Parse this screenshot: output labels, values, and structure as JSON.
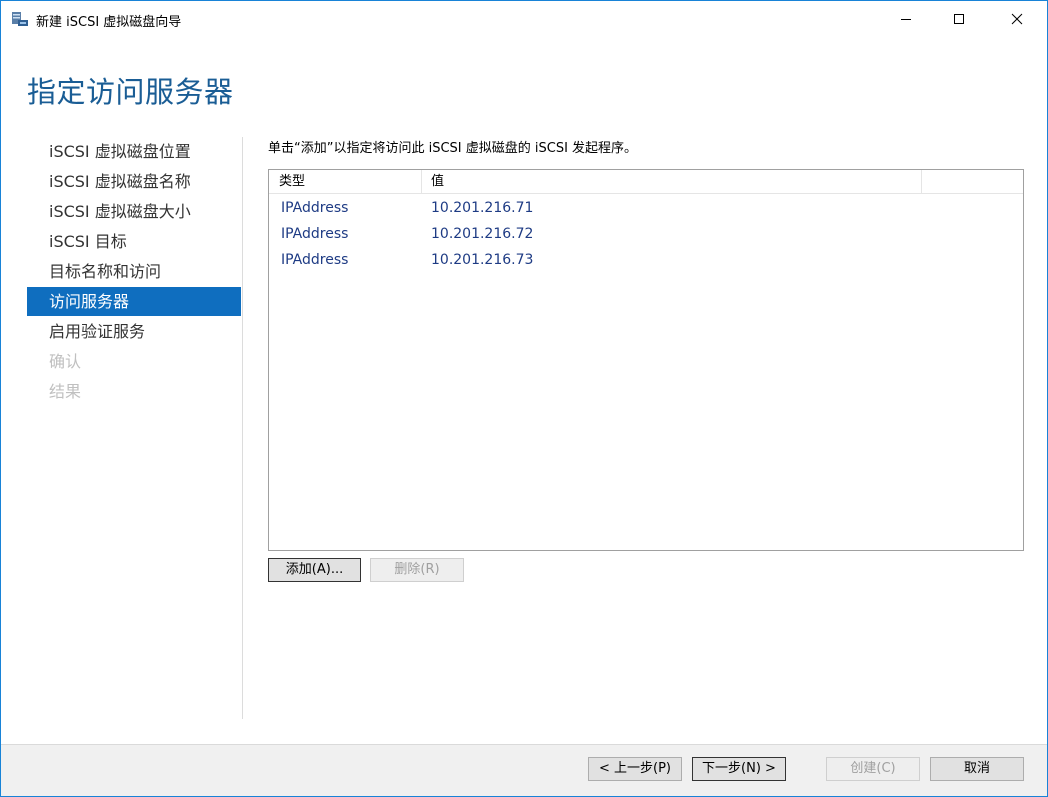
{
  "window": {
    "title": "新建 iSCSI 虚拟磁盘向导",
    "accent_color": "#1883d7"
  },
  "page": {
    "title": "指定访问服务器",
    "instruction": "单击“添加”以指定将访问此 iSCSI 虚拟磁盘的 iSCSI 发起程序。"
  },
  "nav": {
    "items": [
      {
        "label": "iSCSI 虚拟磁盘位置",
        "state": "normal"
      },
      {
        "label": "iSCSI 虚拟磁盘名称",
        "state": "normal"
      },
      {
        "label": "iSCSI 虚拟磁盘大小",
        "state": "normal"
      },
      {
        "label": "iSCSI 目标",
        "state": "normal"
      },
      {
        "label": "目标名称和访问",
        "state": "normal"
      },
      {
        "label": "访问服务器",
        "state": "selected"
      },
      {
        "label": "启用验证服务",
        "state": "normal"
      },
      {
        "label": "确认",
        "state": "disabled"
      },
      {
        "label": "结果",
        "state": "disabled"
      }
    ]
  },
  "list": {
    "columns": [
      "类型",
      "值"
    ],
    "rows": [
      {
        "type": "IPAddress",
        "value": "10.201.216.71"
      },
      {
        "type": "IPAddress",
        "value": "10.201.216.72"
      },
      {
        "type": "IPAddress",
        "value": "10.201.216.73"
      }
    ]
  },
  "buttons": {
    "add": "添加(A)...",
    "remove": "删除(R)",
    "previous": "< 上一步(P)",
    "next": "下一步(N) >",
    "create": "创建(C)",
    "cancel": "取消"
  },
  "icons": {
    "app": "server-disk-icon",
    "minimize": "minimize-icon",
    "maximize": "maximize-icon",
    "close": "close-icon"
  }
}
